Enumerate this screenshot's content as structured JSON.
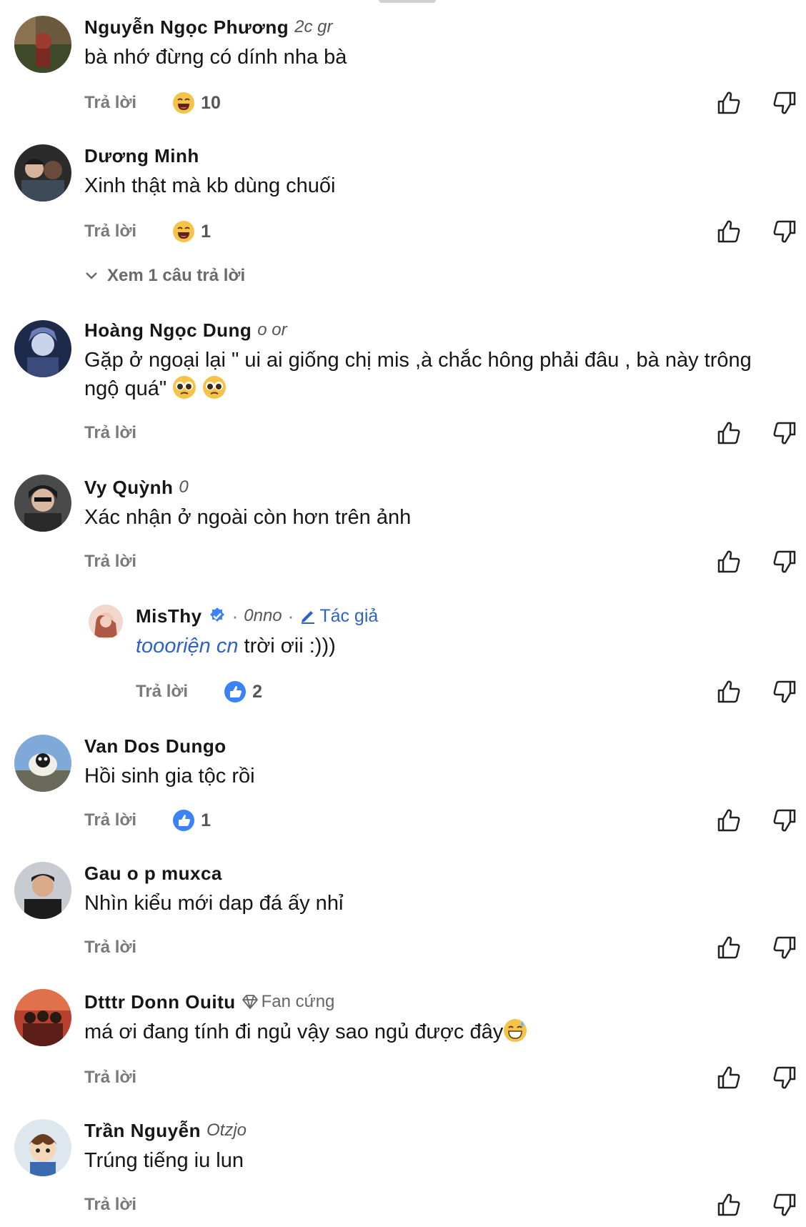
{
  "ui": {
    "reply_label": "Trả lời",
    "author_label": "Tác giả",
    "fan_label": "Fan cứng",
    "meta_separator": "·"
  },
  "colors": {
    "name": "#161616",
    "secondary": "#777777",
    "author_blue": "#2e62c9",
    "like_blue": "#3b82f6"
  },
  "comments": [
    {
      "name": "Nguyễn Ngọc Phương",
      "handle": "2c gr",
      "text": "bà nhớ đừng có dính nha bà",
      "reaction": {
        "icon": "laughing-emoji",
        "count": "10"
      }
    },
    {
      "name": "Dương Minh",
      "handle": "",
      "text": "Xinh thật mà kb dùng chuối",
      "reaction": {
        "icon": "laughing-emoji",
        "count": "1"
      },
      "view_replies": "Xem 1 câu trả lời"
    },
    {
      "name": "Hoàng Ngọc Dung",
      "handle": "o or",
      "text": "Gặp ở ngoại lại \" ui ai giống chị mis ,à chắc hông phải đâu , bà này trông ngộ quá\"",
      "text_emojis": "pleading-face-emoji x2"
    },
    {
      "name": "Vy Quỳnh",
      "handle": "0",
      "text": "Xác nhận ở ngoài còn hơn trên ảnh",
      "reply": {
        "name": "MisThy",
        "handle": "0nno",
        "text_prefix": "toooriện cn",
        "text": " trời ơii :)))",
        "reaction": {
          "icon": "like-reaction",
          "count": "2"
        }
      }
    },
    {
      "name": "Van Dos Dungo",
      "handle": "",
      "text": "Hồi sinh gia tộc rồi",
      "reaction": {
        "icon": "like-reaction",
        "count": "1"
      }
    },
    {
      "name": "Gau o p muxca",
      "handle": "",
      "text": "Nhìn kiểu mới dap đá ấy nhỉ"
    },
    {
      "name": "Dtttr Donn Ouitu",
      "handle": "",
      "text": "má ơi đang tính đi ngủ vậy sao ngủ được đây",
      "text_emoji": "grinning-sweat-emoji",
      "fan": true
    },
    {
      "name": "Trần Nguyễn",
      "handle": "Otzjo",
      "text": "Trúng tiếng iu lun"
    }
  ]
}
